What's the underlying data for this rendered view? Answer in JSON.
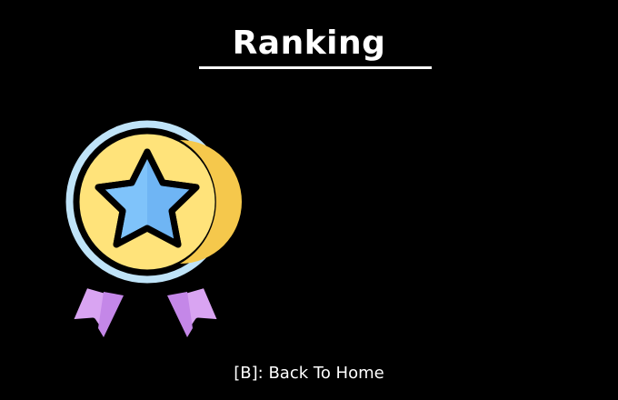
{
  "screen": {
    "title": "Ranking",
    "footer_hint": "[B]: Back To Home"
  },
  "icons": {
    "medal": "medal-star-icon"
  },
  "colors": {
    "background": "#000000",
    "text": "#ffffff",
    "medal_gold": "#FFE37A",
    "medal_gold_shade": "#F5C84C",
    "medal_rim": "#BFE3F8",
    "star": "#7FC3FA",
    "star_shade": "#5FA8EE",
    "ribbon": "#D9A4F2",
    "ribbon_shade": "#C487E8",
    "outline": "#000000"
  }
}
